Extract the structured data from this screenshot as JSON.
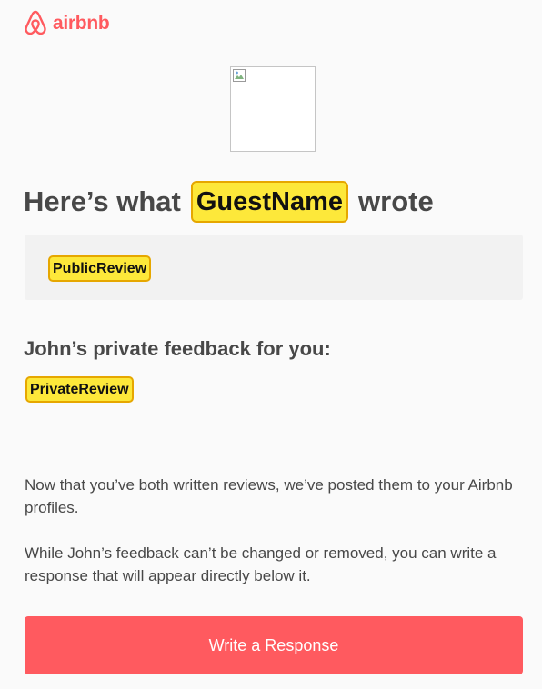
{
  "brand": {
    "wordmark": "airbnb",
    "logo_icon": "airbnb-belo-icon",
    "color": "#ff5a5f"
  },
  "avatar": {
    "icon": "broken-image-icon"
  },
  "headline": {
    "prefix": "Here’s what",
    "guest_token": "GuestName",
    "suffix": "wrote"
  },
  "public_review": {
    "token": "PublicReview"
  },
  "private_feedback": {
    "title": "John’s private feedback for you:",
    "token": "PrivateReview"
  },
  "body": {
    "paragraph_1": "Now that you’ve both written reviews, we’ve posted them to your Airbnb profiles.",
    "paragraph_2": "While John’s feedback can’t be changed or removed, you can write a response that will appear directly below it."
  },
  "cta": {
    "label": "Write a Response",
    "color": "#ff5a5f"
  },
  "colors": {
    "token_fill": "#fde83a",
    "token_border": "#e6a700",
    "text": "#484848"
  }
}
